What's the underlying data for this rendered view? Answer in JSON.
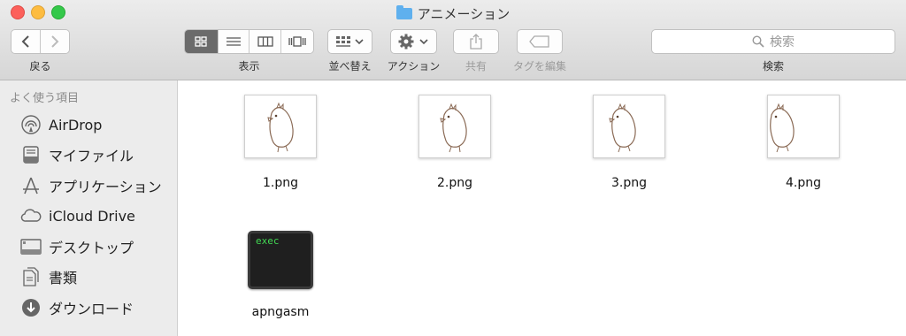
{
  "window": {
    "title": "アニメーション",
    "title_icon": "folder-icon"
  },
  "toolbar": {
    "back_label": "戻る",
    "view_label": "表示",
    "arrange_label": "並べ替え",
    "action_label": "アクション",
    "share_label": "共有",
    "tags_label": "タグを編集",
    "search_label": "検索",
    "search_placeholder": "検索"
  },
  "sidebar": {
    "heading": "よく使う項目",
    "items": [
      {
        "label": "AirDrop",
        "icon": "airdrop-icon"
      },
      {
        "label": "マイファイル",
        "icon": "all-my-files-icon"
      },
      {
        "label": "アプリケーション",
        "icon": "applications-icon"
      },
      {
        "label": "iCloud Drive",
        "icon": "cloud-icon"
      },
      {
        "label": "デスクトップ",
        "icon": "desktop-icon"
      },
      {
        "label": "書類",
        "icon": "documents-icon"
      },
      {
        "label": "ダウンロード",
        "icon": "downloads-icon"
      }
    ]
  },
  "files": [
    {
      "name": "1.png"
    },
    {
      "name": "2.png"
    },
    {
      "name": "3.png"
    },
    {
      "name": "4.png"
    },
    {
      "name": "apngasm",
      "icon_text": "exec"
    }
  ]
}
